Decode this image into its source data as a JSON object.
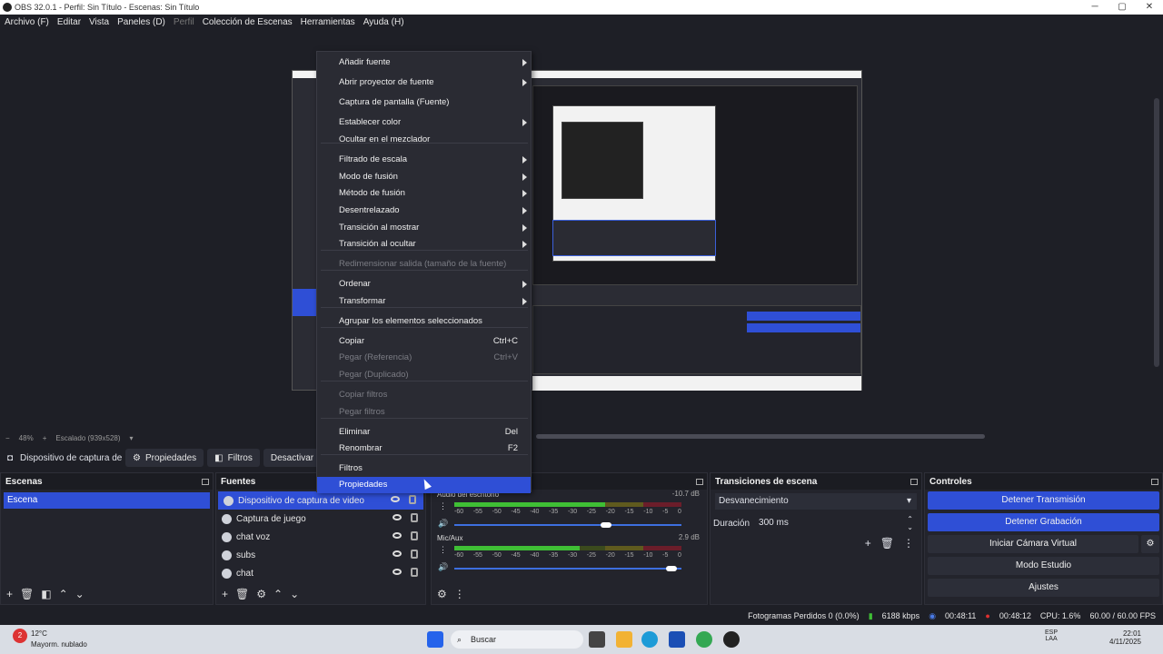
{
  "window": {
    "title": "OBS 32.0.1 - Perfil: Sin Título - Escenas: Sin Título",
    "minimize": "─",
    "maximize": "▢",
    "close": "✕"
  },
  "menu": [
    "Archivo (F)",
    "Editar",
    "Vista",
    "Paneles (D)",
    "Perfil",
    "Colección de Escenas",
    "Herramientas",
    "Ayuda (H)"
  ],
  "zoombar": {
    "minus": "−",
    "zoom": "48%",
    "plus": "+",
    "scaled": "Escalado (939x528)"
  },
  "source_toolbar": {
    "source_name": "Dispositivo de captura de v",
    "properties": "Propiedades",
    "filters": "Filtros",
    "deactivate": "Desactivar"
  },
  "scenes": {
    "title": "Escenas",
    "items": [
      "Escena"
    ]
  },
  "sources": {
    "title": "Fuentes",
    "items": [
      "Dispositivo de captura de video",
      "Captura de juego",
      "chat voz",
      "subs",
      "chat"
    ]
  },
  "mixer": {
    "tracks": [
      {
        "name": "Audio del escritorio",
        "db": "-10.7 dB",
        "level": 0.78,
        "volume": 0.69
      },
      {
        "name": "Mic/Aux",
        "db": "2.9 dB",
        "level": 0.55,
        "volume": 0.98
      }
    ],
    "ticks": [
      "-60",
      "-55",
      "-50",
      "-45",
      "-40",
      "-35",
      "-30",
      "-25",
      "-20",
      "-15",
      "-10",
      "-5",
      "0"
    ]
  },
  "transitions": {
    "title": "Transiciones de escena",
    "selected": "Desvanecimiento",
    "duration_label": "Duración",
    "duration_value": "300 ms"
  },
  "controls": {
    "title": "Controles",
    "stop_stream": "Detener Transmisión",
    "stop_record": "Detener Grabación",
    "virtual_cam": "Iniciar Cámara Virtual",
    "studio_mode": "Modo Estudio",
    "settings": "Ajustes"
  },
  "status": {
    "dropped": "Fotogramas Perdidos 0 (0.0%)",
    "kbps": "6188 kbps",
    "stream_time": "00:48:11",
    "rec_time": "00:48:12",
    "cpu": "CPU: 1.6%",
    "fps": "60.00 / 60.00 FPS"
  },
  "context_menu": {
    "items": [
      {
        "label": "Añadir fuente",
        "sub": true
      },
      {
        "label": "Abrir proyector de fuente",
        "sub": true
      },
      {
        "label": "Captura de pantalla (Fuente)"
      },
      {
        "label": "Establecer color",
        "sub": true
      },
      {
        "label": "Ocultar en el mezclador"
      },
      {
        "label": "Filtrado de escala",
        "sub": true
      },
      {
        "label": "Modo de fusión",
        "sub": true
      },
      {
        "label": "Método de fusión",
        "sub": true
      },
      {
        "label": "Desentrelazado",
        "sub": true
      },
      {
        "label": "Transición al mostrar",
        "sub": true
      },
      {
        "label": "Transición al ocultar",
        "sub": true
      },
      {
        "label": "Redimensionar salida (tamaño de la fuente)",
        "disabled": true
      },
      {
        "label": "Ordenar",
        "sub": true
      },
      {
        "label": "Transformar",
        "sub": true
      },
      {
        "label": "Agrupar los elementos seleccionados"
      },
      {
        "label": "Copiar",
        "shortcut": "Ctrl+C"
      },
      {
        "label": "Pegar (Referencia)",
        "shortcut": "Ctrl+V",
        "disabled": true
      },
      {
        "label": "Pegar (Duplicado)",
        "disabled": true
      },
      {
        "label": "Copiar filtros",
        "disabled": true
      },
      {
        "label": "Pegar filtros",
        "disabled": true
      },
      {
        "label": "Eliminar",
        "shortcut": "Del"
      },
      {
        "label": "Renombrar",
        "shortcut": "F2"
      },
      {
        "label": "Filtros"
      },
      {
        "label": "Propiedades",
        "highlighted": true
      }
    ]
  },
  "taskbar": {
    "weather_badge": "2",
    "weather_temp": "12°C",
    "weather_desc": "Mayorm. nublado",
    "search": "Buscar",
    "lang1": "ESP",
    "lang2": "LAA",
    "time": "22:01",
    "date": "4/11/2025"
  }
}
